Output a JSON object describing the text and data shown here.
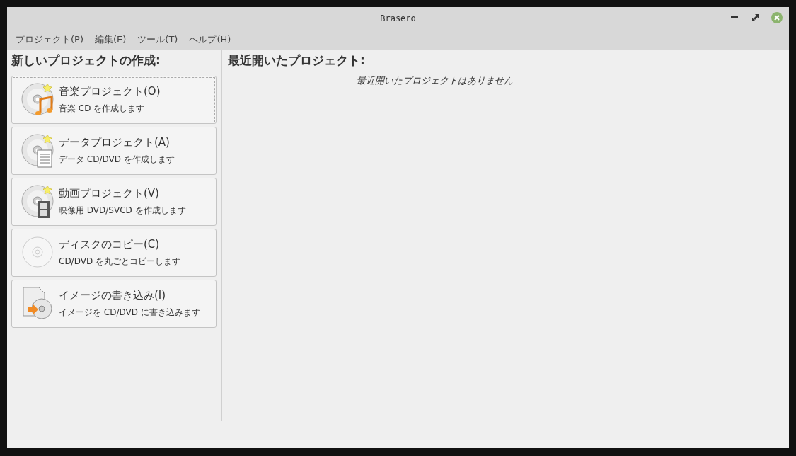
{
  "window": {
    "title": "Brasero"
  },
  "menu": [
    {
      "label": "プロジェクト(P)"
    },
    {
      "label": "編集(E)"
    },
    {
      "label": "ツール(T)"
    },
    {
      "label": "ヘルプ(H)"
    }
  ],
  "new_project": {
    "heading": "新しいプロジェクトの作成:",
    "items": [
      {
        "kind": "audio",
        "title": "音楽プロジェクト(O)",
        "description": "音楽 CD を作成します",
        "focused": true
      },
      {
        "kind": "data",
        "title": "データプロジェクト(A)",
        "description": "データ CD/DVD を作成します",
        "focused": false
      },
      {
        "kind": "video",
        "title": "動画プロジェクト(V)",
        "description": "映像用 DVD/SVCD を作成します",
        "focused": false
      },
      {
        "kind": "copy",
        "title": "ディスクのコピー(C)",
        "description": "CD/DVD を丸ごとコピーします",
        "focused": false
      },
      {
        "kind": "image",
        "title": "イメージの書き込み(I)",
        "description": "イメージを CD/DVD に書き込みます",
        "focused": false
      }
    ]
  },
  "recent": {
    "heading": "最近開いたプロジェクト:",
    "empty_message": "最近開いたプロジェクトはありません"
  }
}
